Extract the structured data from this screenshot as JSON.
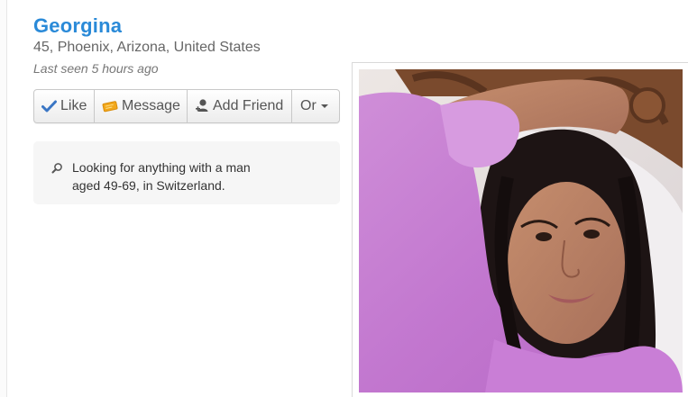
{
  "profile": {
    "name": "Georgina",
    "location": "45, Phoenix, Arizona, United States",
    "last_seen": "Last seen 5 hours ago"
  },
  "actions": {
    "like": "Like",
    "message": "Message",
    "add_friend": "Add Friend",
    "more": "Or"
  },
  "looking_for": {
    "line1": "Looking for anything with a man",
    "line2": "aged 49-69, in Switzerland."
  },
  "photo": {
    "icon": "profile-photo"
  },
  "colors": {
    "name_link": "#2a8ad8",
    "like_check": "#3a76c4",
    "message_ticket": "#f2a81c"
  }
}
